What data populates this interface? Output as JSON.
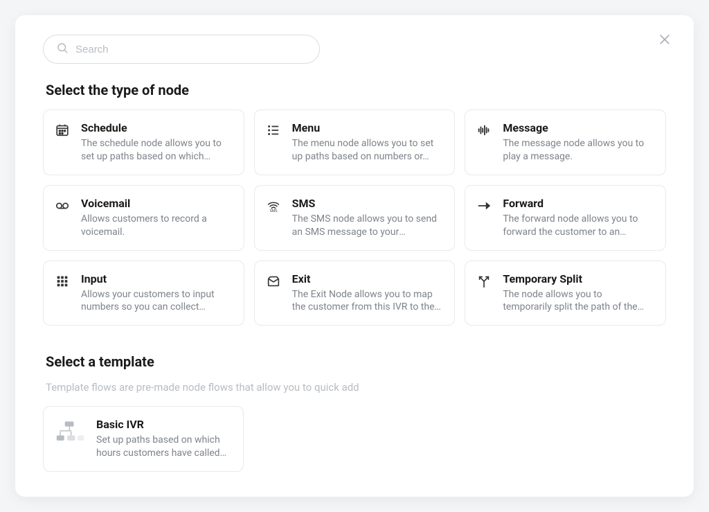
{
  "search": {
    "placeholder": "Search"
  },
  "close": {
    "aria": "Close"
  },
  "section_nodes": {
    "title": "Select the type of node"
  },
  "nodes": [
    {
      "title": "Schedule",
      "desc": "The schedule node allows you to set up paths based on which hour…"
    },
    {
      "title": "Menu",
      "desc": "The menu node allows you to set up paths based on numbers or…"
    },
    {
      "title": "Message",
      "desc": "The message node allows you to play a message."
    },
    {
      "title": "Voicemail",
      "desc": "Allows customers to record a voicemail."
    },
    {
      "title": "SMS",
      "desc": "The SMS node allows you to send an SMS message to your customer."
    },
    {
      "title": "Forward",
      "desc": "The forward node allows you to forward the customer to an…"
    },
    {
      "title": "Input",
      "desc": "Allows your customers to input numbers so you can collect…"
    },
    {
      "title": "Exit",
      "desc": "The Exit Node allows you to map the customer from this IVR to the…"
    },
    {
      "title": "Temporary Split",
      "desc": "The node allows you to temporarily split the path of the IVR and steer…"
    }
  ],
  "section_templates": {
    "title": "Select a template",
    "subtitle": "Template flows are pre-made node flows that allow you to quick add"
  },
  "templates": [
    {
      "title": "Basic IVR",
      "desc": "Set up paths based on which hours customers have called…"
    }
  ]
}
